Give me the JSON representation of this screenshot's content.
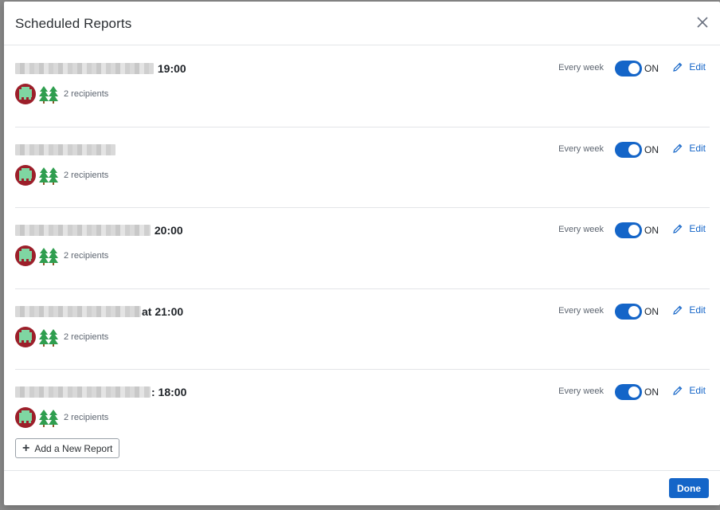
{
  "modal": {
    "title": "Scheduled Reports",
    "close_icon": "close-icon"
  },
  "reports": [
    {
      "title_suffix": " 19:00",
      "recipients": "2 recipients",
      "frequency": "Every week",
      "toggle_label": "ON",
      "toggle_on": true,
      "edit_label": "Edit"
    },
    {
      "title_suffix": "",
      "recipients": "2 recipients",
      "frequency": "Every week",
      "toggle_label": "ON",
      "toggle_on": true,
      "edit_label": "Edit"
    },
    {
      "title_suffix": " 20:00",
      "recipients": "2 recipients",
      "frequency": "Every week",
      "toggle_label": "ON",
      "toggle_on": true,
      "edit_label": "Edit"
    },
    {
      "title_suffix": "at 21:00",
      "recipients": "2 recipients",
      "frequency": "Every week",
      "toggle_label": "ON",
      "toggle_on": true,
      "edit_label": "Edit"
    },
    {
      "title_suffix": ": 18:00",
      "recipients": "2 recipients",
      "frequency": "Every week",
      "toggle_label": "ON",
      "toggle_on": true,
      "edit_label": "Edit"
    }
  ],
  "add_button": {
    "label": "Add a New Report",
    "icon": "plus-icon"
  },
  "footer": {
    "done_label": "Done"
  },
  "colors": {
    "accent": "#1465c8",
    "avatar_bg": "#9c1f2a",
    "avatar_fg": "#7fd6a2",
    "tree_green": "#2f9e4f"
  }
}
